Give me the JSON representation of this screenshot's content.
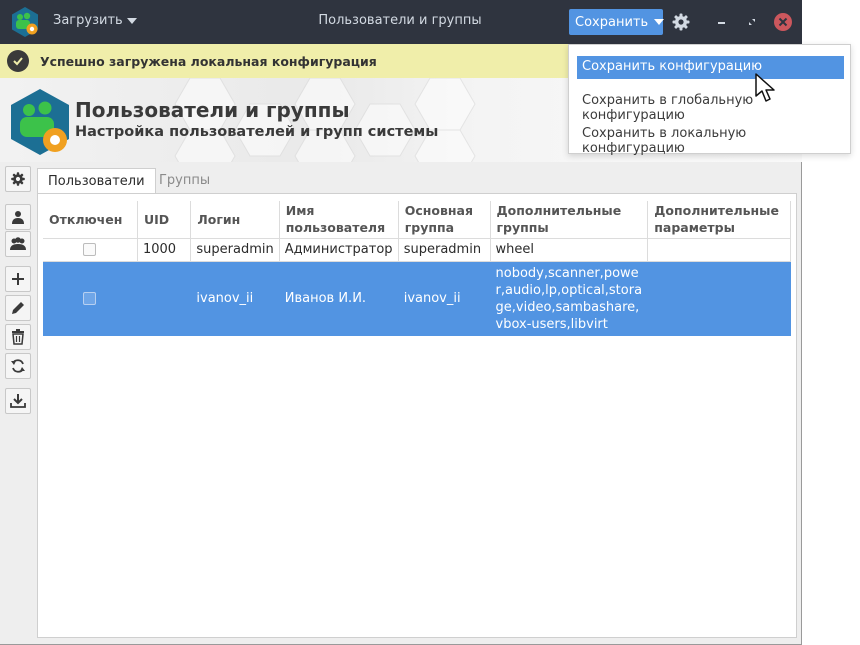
{
  "titlebar": {
    "load_label": "Загрузить",
    "title": "Пользователи и группы",
    "save_label": "Сохранить"
  },
  "notification": {
    "text": "Успешно загружена локальная конфигурация"
  },
  "banner": {
    "title": "Пользователи и группы",
    "subtitle": "Настройка пользователей и групп системы"
  },
  "tabs": {
    "users": "Пользователи",
    "groups": "Группы"
  },
  "table": {
    "headers": [
      "Отключен",
      "UID",
      "Логин",
      "Имя пользователя",
      "Основная группа",
      "Дополнительные группы",
      "Дополнительные параметры"
    ],
    "rows": [
      {
        "disabled": false,
        "uid": "1000",
        "login": "superadmin",
        "name": "Администратор",
        "group": "superadmin",
        "extra_groups": "wheel",
        "extra_params": ""
      },
      {
        "disabled": false,
        "uid": "",
        "login": "ivanov_ii",
        "name": "Иванов И.И.",
        "group": "ivanov_ii",
        "extra_groups": "nobody,scanner,power,audio,lp,optical,storage,video,sambashare,vbox-users,libvirt",
        "extra_params": ""
      }
    ]
  },
  "save_menu": {
    "items": [
      "Сохранить конфигурацию",
      "Сохранить в глобальную конфигурацию",
      "Сохранить в локальную конфигурацию"
    ]
  },
  "colors": {
    "titlebar": "#2f343f",
    "accent": "#5294e2",
    "notification": "#f0eeaa",
    "close": "#cc575d"
  },
  "icons": [
    "app-icon",
    "chevron-down-icon",
    "settings-gear-icon",
    "minimize-icon",
    "maximize-icon",
    "close-icon",
    "check-circle-icon",
    "users-gear-icon",
    "user-icon",
    "group-icon",
    "plus-icon",
    "pencil-icon",
    "trash-icon",
    "refresh-icon",
    "download-icon",
    "mouse-cursor-icon"
  ]
}
